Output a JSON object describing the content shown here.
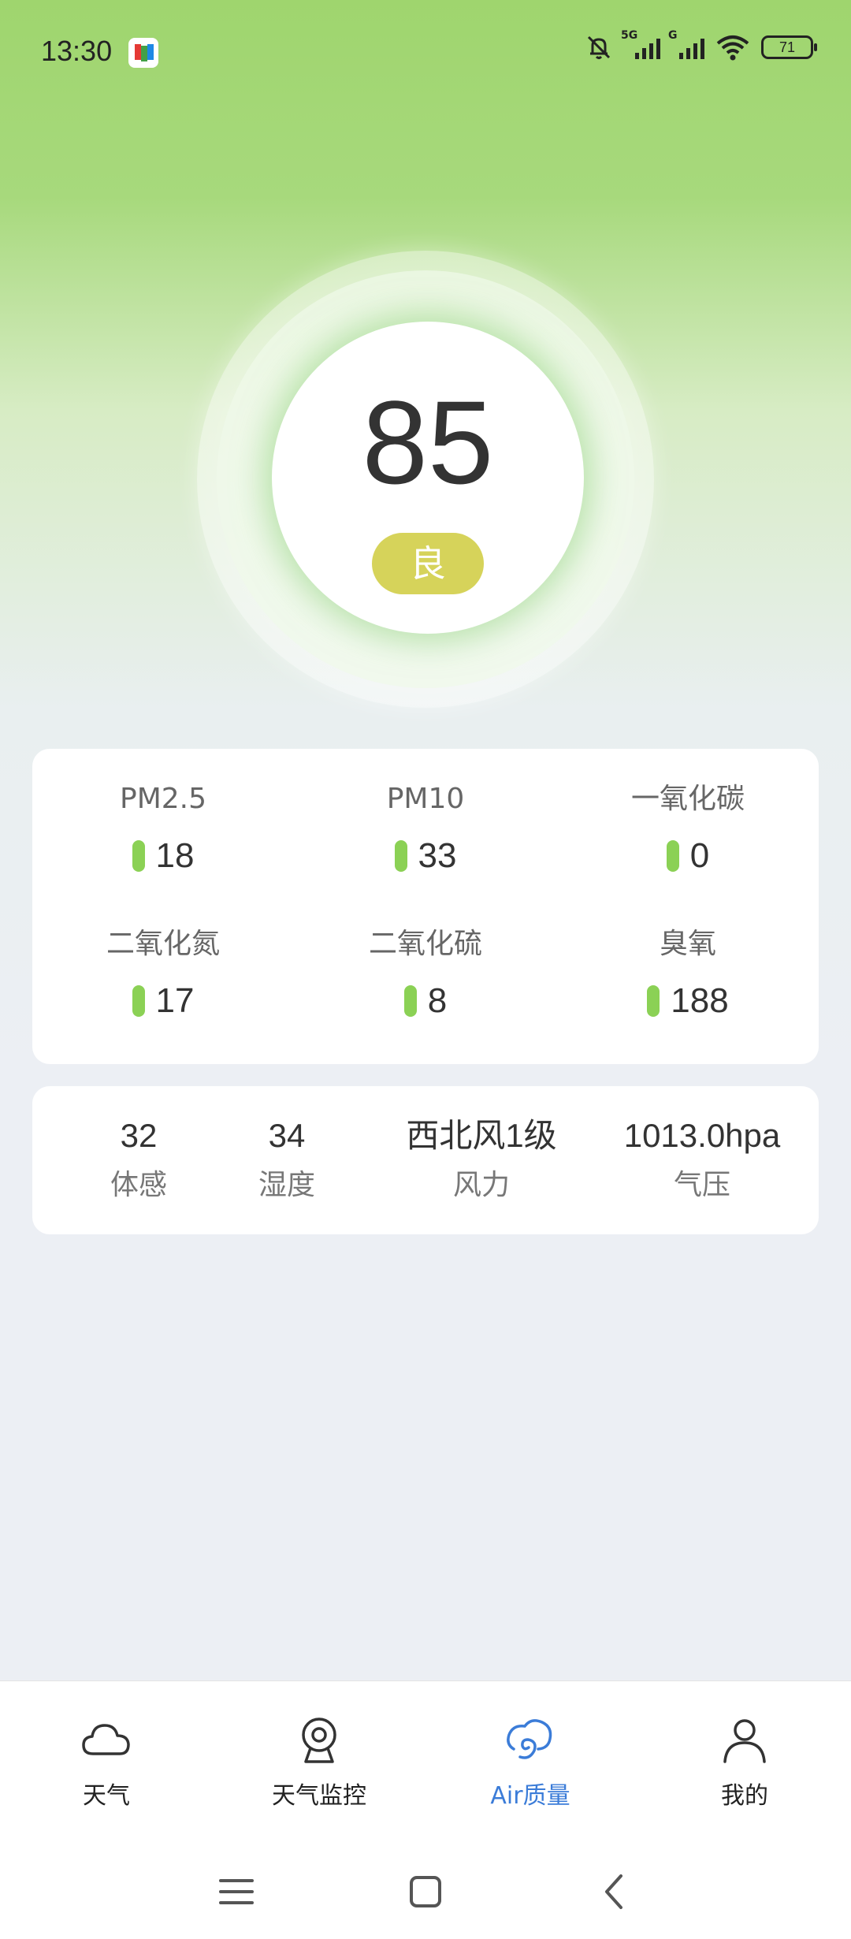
{
  "status_bar": {
    "time": "13:30",
    "battery": "71",
    "signal1_label": "5G",
    "signal2_label": "G"
  },
  "aqi": {
    "value": "85",
    "level": "良",
    "level_color": "#d6d35a"
  },
  "pollutants": [
    {
      "name": "PM2.5",
      "value": "18"
    },
    {
      "name": "PM10",
      "value": "33"
    },
    {
      "name": "一氧化碳",
      "value": "0"
    },
    {
      "name": "二氧化氮",
      "value": "17"
    },
    {
      "name": "二氧化硫",
      "value": "8"
    },
    {
      "name": "臭氧",
      "value": "188"
    }
  ],
  "indicator_color": "#8bd155",
  "weather": [
    {
      "value": "32",
      "label": "体感"
    },
    {
      "value": "34",
      "label": "湿度"
    },
    {
      "value": "西北风1级",
      "label": "风力"
    },
    {
      "value": "1013.0hpa",
      "label": "气压"
    }
  ],
  "nav": [
    {
      "label": "天气",
      "icon": "cloud-icon",
      "active": false
    },
    {
      "label": "天气监控",
      "icon": "webcam-icon",
      "active": false
    },
    {
      "label": "Air质量",
      "icon": "air-quality-icon",
      "active": true
    },
    {
      "label": "我的",
      "icon": "person-icon",
      "active": false
    }
  ],
  "accent_color": "#3b7cd8"
}
